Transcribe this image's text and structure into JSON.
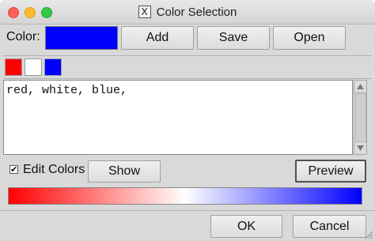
{
  "window": {
    "title": "Color Selection",
    "app_icon": "x11-icon"
  },
  "toolbar": {
    "color_label": "Color:",
    "current_color": "#0000ff",
    "add_label": "Add",
    "save_label": "Save",
    "open_label": "Open"
  },
  "swatches": [
    {
      "name": "red",
      "color": "#ff0000"
    },
    {
      "name": "white",
      "color": "#ffffff"
    },
    {
      "name": "blue",
      "color": "#0000ff"
    }
  ],
  "editor": {
    "text": "red, white, blue,"
  },
  "options": {
    "edit_colors_label": "Edit Colors",
    "edit_colors_checked": true,
    "show_label": "Show",
    "preview_label": "Preview"
  },
  "gradient": {
    "stops": [
      "#ff0000",
      "#ffffff",
      "#0000ff"
    ]
  },
  "footer": {
    "ok_label": "OK",
    "cancel_label": "Cancel"
  }
}
